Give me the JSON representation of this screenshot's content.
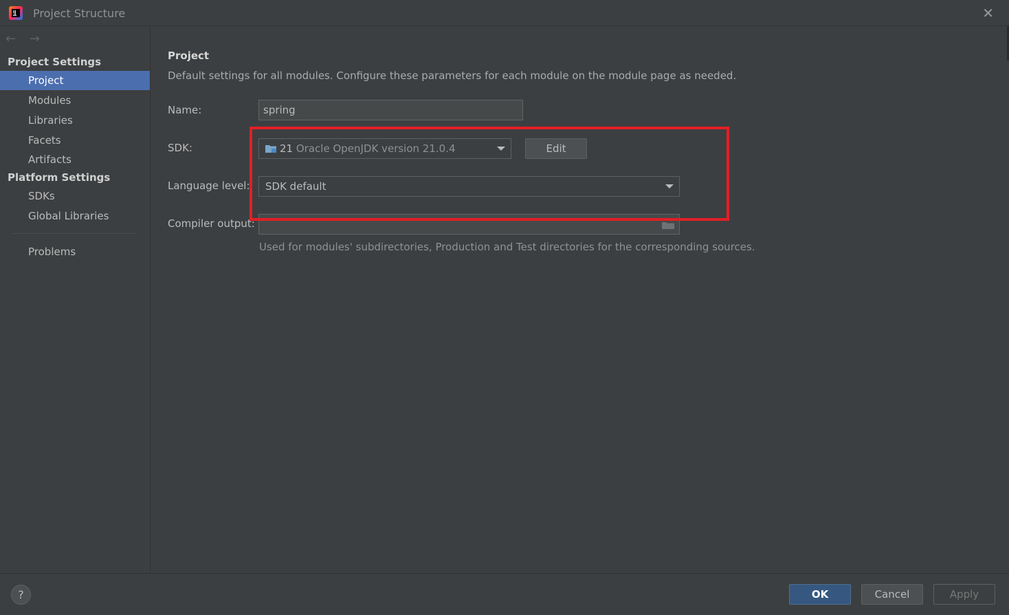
{
  "window": {
    "title": "Project Structure",
    "close_glyph": "✕",
    "app_icon": "intellij-idea-icon"
  },
  "sidebar": {
    "back_glyph": "←",
    "forward_glyph": "→",
    "groups": [
      {
        "header": "Project Settings",
        "items": [
          "Project",
          "Modules",
          "Libraries",
          "Facets",
          "Artifacts"
        ]
      },
      {
        "header": "Platform Settings",
        "items": [
          "SDKs",
          "Global Libraries"
        ]
      }
    ],
    "problems_label": "Problems",
    "selected_item": "Project"
  },
  "main": {
    "title": "Project",
    "description": "Default settings for all modules. Configure these parameters for each module on the module page as needed.",
    "name": {
      "label": "Name:",
      "value": "spring"
    },
    "sdk": {
      "label": "SDK:",
      "number": "21",
      "version": "Oracle OpenJDK version 21.0.4",
      "edit_label": "Edit"
    },
    "language_level": {
      "label": "Language level:",
      "value": "SDK default"
    },
    "compiler_output": {
      "label": "Compiler output:",
      "value": "",
      "hint": "Used for modules' subdirectories, Production and Test directories for the corresponding sources."
    }
  },
  "footer": {
    "help_glyph": "?",
    "ok_label": "OK",
    "cancel_label": "Cancel",
    "apply_label": "Apply"
  },
  "colors": {
    "selection": "#4b6eaf",
    "highlight_box": "#e21f26",
    "ok_button": "#365880"
  }
}
